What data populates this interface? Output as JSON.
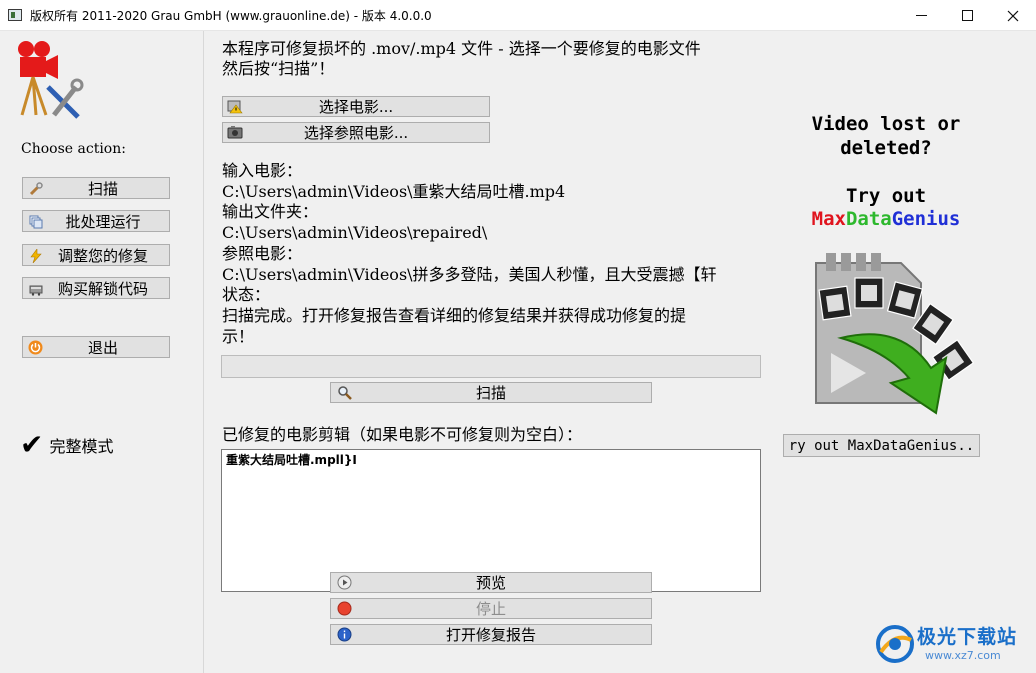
{
  "window": {
    "title": "版权所有 2011-2020 Grau GmbH (www.grauonline.de) - 版本 4.0.0.0"
  },
  "sidebar": {
    "choose_label": "Choose action:",
    "buttons": [
      {
        "label": "扫描",
        "icon": "wrench-icon"
      },
      {
        "label": "批处理运行",
        "icon": "batch-icon"
      },
      {
        "label": "调整您的修复",
        "icon": "lightning-icon"
      },
      {
        "label": "购买解锁代码",
        "icon": "cart-icon"
      },
      {
        "label": "退出",
        "icon": "power-icon"
      }
    ],
    "full_mode_label": "完整模式"
  },
  "main": {
    "intro_line1": "本程序可修复损坏的 .mov/.mp4 文件 - 选择一个要修复的电影文件",
    "intro_line2": "然后按“扫描”！",
    "select_movie_label": "选择电影...",
    "select_reference_label": "选择参照电影...",
    "input_movie_label": "输入电影：",
    "input_movie_path": "C:\\Users\\admin\\Videos\\重紫大结局吐槽.mp4",
    "output_folder_label": "输出文件夹：",
    "output_folder_path": "C:\\Users\\admin\\Videos\\repaired\\",
    "reference_movie_label": "参照电影：",
    "reference_movie_path": "C:\\Users\\admin\\Videos\\拼多多登陆，美国人秒懂，且大受震撼【轩",
    "status_label": "状态：",
    "status_line1": "扫描完成。打开修复报告查看详细的修复结果并获得成功修复的提",
    "status_line2": "示！",
    "progress": 0,
    "scan_label": "扫描",
    "repaired_label": "已修复的电影剪辑（如果电影不可修复则为空白）：",
    "repaired_items": [
      "重紫大结局吐槽.mpll}I"
    ],
    "preview_label": "预览",
    "stop_label": "停止",
    "open_report_label": "打开修复报告"
  },
  "ad": {
    "line1": "Video lost or",
    "line2": "deleted?",
    "line3": "Try out",
    "brand": {
      "parts": [
        {
          "text": "Max",
          "color": "#e0141e"
        },
        {
          "text": "Data",
          "color": "#2db82d"
        },
        {
          "text": "Genius",
          "color": "#1f2fd6"
        }
      ]
    },
    "button_label": "ry out MaxDataGenius.."
  },
  "watermark": {
    "text": "极光下载站",
    "url": "www.xz7.com"
  },
  "colors": {
    "button_face": "#e1e1e1",
    "button_border": "#adadad",
    "window_bg": "#f0f0f0"
  }
}
